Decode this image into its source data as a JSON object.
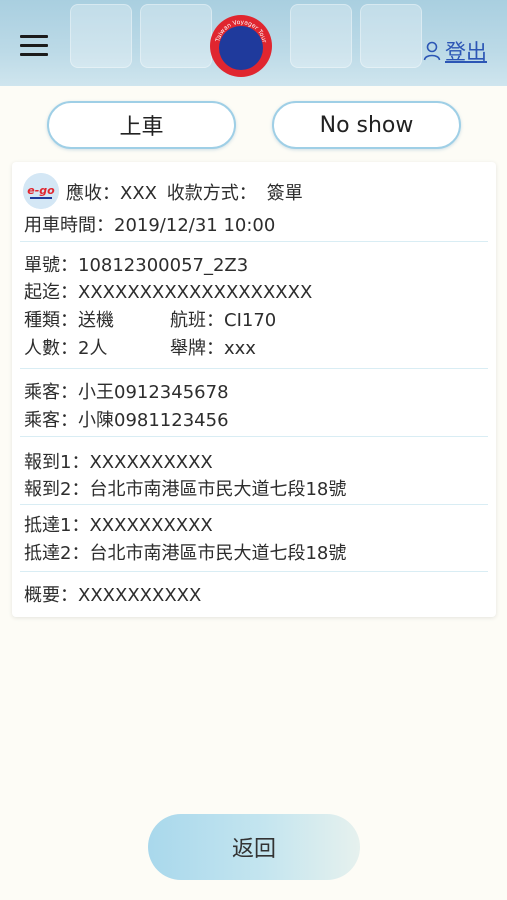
{
  "header": {
    "logo_text": "Taiwan Voyager Tour",
    "logout_label": "登出"
  },
  "actions": {
    "board_label": "上車",
    "noshow_label": "No show"
  },
  "order": {
    "brand_logo_text": "e-go",
    "receivable_label": "應收：",
    "receivable_value": "XXX",
    "payment_label": "收款方式：",
    "payment_value": "簽單",
    "time_label": "用車時間：",
    "time_value": "2019/12/31 10:00",
    "order_no_label": "單號：",
    "order_no_value": "10812300057_2Z3",
    "route_label": "起迄：",
    "route_value": "XXXXXXXXXXXXXXXXXXX",
    "type_label": "種類：",
    "type_value": "送機",
    "flight_label": "航班：",
    "flight_value": "CI170",
    "pax_label": "人數：",
    "pax_value": "2人",
    "sign_label": "舉牌：",
    "sign_value": "xxx",
    "passengers": [
      {
        "label": "乘客：",
        "value": "小王0912345678"
      },
      {
        "label": "乘客：",
        "value": "小陳0981123456"
      }
    ],
    "checkin1_label": "報到1：",
    "checkin1_value": "XXXXXXXXXX",
    "checkin2_label": "報到2：",
    "checkin2_value": "台北市南港區市民大道七段18號",
    "arrive1_label": "抵達1：",
    "arrive1_value": "XXXXXXXXXX",
    "arrive2_label": "抵達2：",
    "arrive2_value": "台北市南港區市民大道七段18號",
    "summary_label": "概要：",
    "summary_value": "XXXXXXXXXX"
  },
  "footer": {
    "return_label": "返回"
  },
  "colors": {
    "accent_blue": "#2c56b5",
    "pill_border": "#9fcfe6",
    "logo_red": "#e0262f",
    "logo_blue": "#1f3a9c"
  }
}
